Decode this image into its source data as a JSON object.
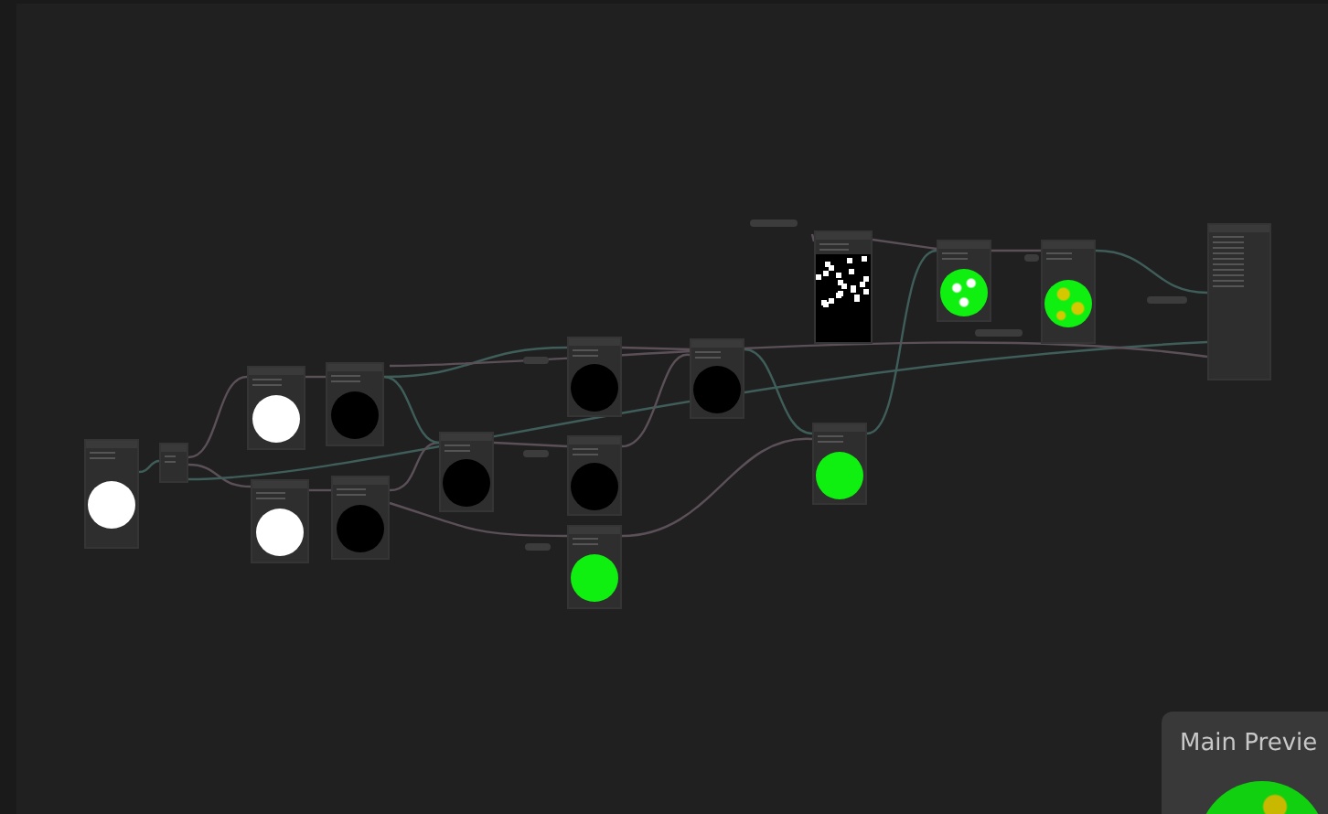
{
  "graph": {
    "nodes": [
      {
        "kind": "white"
      },
      {
        "kind": "plain"
      },
      {
        "kind": "white"
      },
      {
        "kind": "black"
      },
      {
        "kind": "white"
      },
      {
        "kind": "black"
      },
      {
        "kind": "black"
      },
      {
        "kind": "black"
      },
      {
        "kind": "black"
      },
      {
        "kind": "green"
      },
      {
        "kind": "black"
      },
      {
        "kind": "green"
      },
      {
        "kind": "noise"
      },
      {
        "kind": "dotted"
      },
      {
        "kind": "spotted"
      },
      {
        "kind": "master"
      }
    ]
  },
  "main_preview": {
    "title": "Main Previe"
  }
}
